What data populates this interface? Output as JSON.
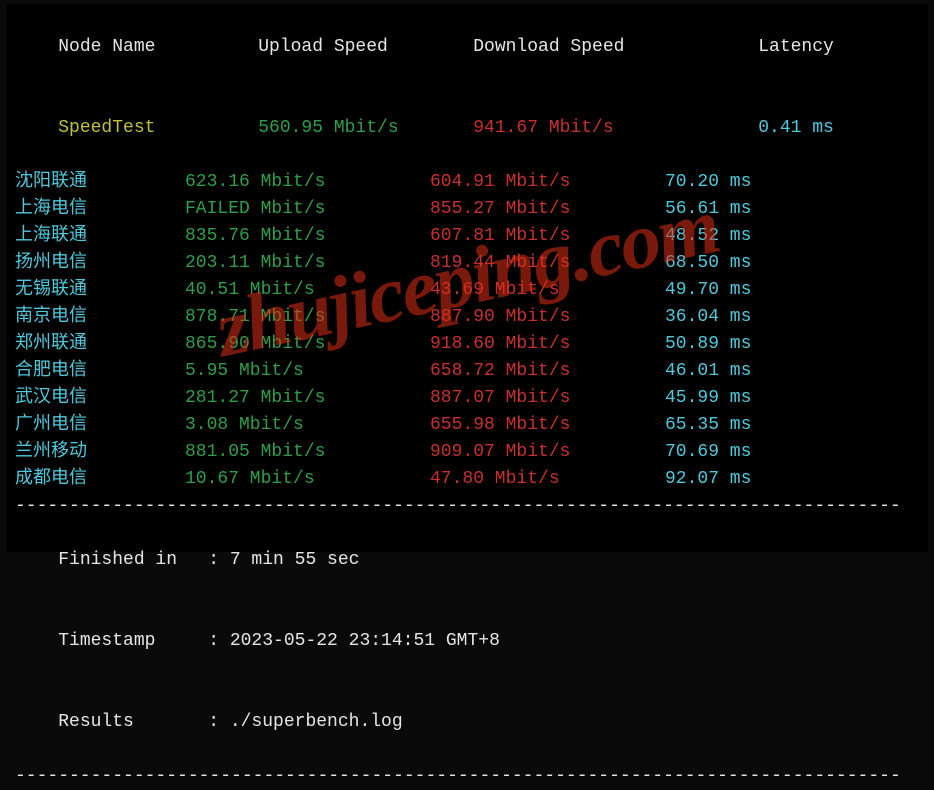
{
  "header": {
    "node": "Node Name",
    "upload": "Upload Speed",
    "download": "Download Speed",
    "latency": "Latency"
  },
  "speedtest": {
    "name": "SpeedTest",
    "upload": "560.95 Mbit/s",
    "download": "941.67 Mbit/s",
    "latency": "0.41 ms"
  },
  "rows": [
    {
      "node": "沈阳联通",
      "upload": "623.16 Mbit/s",
      "download": "604.91 Mbit/s",
      "latency": "70.20 ms"
    },
    {
      "node": "上海电信",
      "upload": "FAILED Mbit/s",
      "download": "855.27 Mbit/s",
      "latency": "56.61 ms"
    },
    {
      "node": "上海联通",
      "upload": "835.76 Mbit/s",
      "download": "607.81 Mbit/s",
      "latency": "48.52 ms"
    },
    {
      "node": "扬州电信",
      "upload": "203.11 Mbit/s",
      "download": "819.44 Mbit/s",
      "latency": "68.50 ms"
    },
    {
      "node": "无锡联通",
      "upload": "40.51 Mbit/s",
      "download": "43.69 Mbit/s",
      "latency": "49.70 ms"
    },
    {
      "node": "南京电信",
      "upload": "878.71 Mbit/s",
      "download": "887.90 Mbit/s",
      "latency": "36.04 ms"
    },
    {
      "node": "郑州联通",
      "upload": "865.90 Mbit/s",
      "download": "918.60 Mbit/s",
      "latency": "50.89 ms"
    },
    {
      "node": "合肥电信",
      "upload": "5.95 Mbit/s",
      "download": "658.72 Mbit/s",
      "latency": "46.01 ms"
    },
    {
      "node": "武汉电信",
      "upload": "281.27 Mbit/s",
      "download": "887.07 Mbit/s",
      "latency": "45.99 ms"
    },
    {
      "node": "广州电信",
      "upload": "3.08 Mbit/s",
      "download": "655.98 Mbit/s",
      "latency": "65.35 ms"
    },
    {
      "node": "兰州移动",
      "upload": "881.05 Mbit/s",
      "download": "909.07 Mbit/s",
      "latency": "70.69 ms"
    },
    {
      "node": "成都电信",
      "upload": "10.67 Mbit/s",
      "download": "47.80 Mbit/s",
      "latency": "92.07 ms"
    }
  ],
  "footer": {
    "finished_label": "Finished in",
    "finished_value": "7 min 55 sec",
    "timestamp_label": "Timestamp",
    "timestamp_value": "2023-05-22 23:14:51 GMT+8",
    "results_label": "Results",
    "results_value": "./superbench.log"
  },
  "watermark": "zhujiceping.com",
  "dash": "----------------------------------------------------------------------------------"
}
